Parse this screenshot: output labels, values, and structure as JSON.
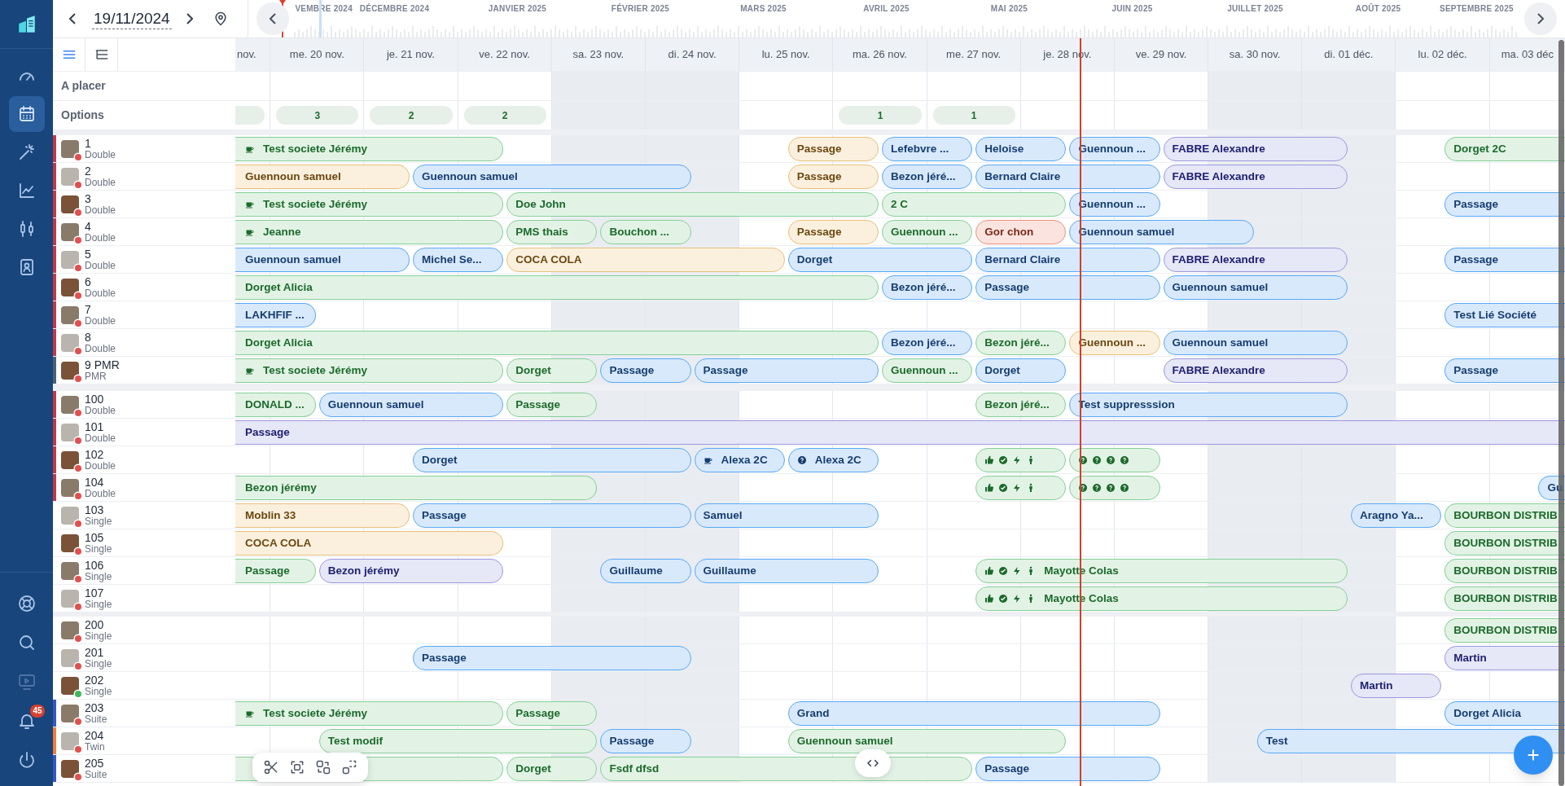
{
  "nav": {
    "top": [
      {
        "kind": "gauge",
        "selected": false
      },
      {
        "kind": "calendar",
        "selected": true
      },
      {
        "kind": "wand",
        "selected": false
      },
      {
        "kind": "chart",
        "selected": false
      },
      {
        "kind": "candles",
        "selected": false
      },
      {
        "kind": "contact",
        "selected": false
      }
    ],
    "bottom": [
      {
        "kind": "lifebuoy",
        "disabled": false
      },
      {
        "kind": "search",
        "disabled": false
      },
      {
        "kind": "monitor",
        "disabled": true
      },
      {
        "kind": "bell",
        "disabled": false,
        "badge": "45"
      },
      {
        "kind": "power",
        "disabled": false
      }
    ]
  },
  "date": "19/11/2024",
  "months": [
    "VEMBRE 2024",
    "DÉCEMBRE 2024",
    "JANVIER 2025",
    "FÉVRIER 2025",
    "MARS 2025",
    "AVRIL 2025",
    "MAI 2025",
    "JUIN 2025",
    "JUILLET 2025",
    "AOÛT 2025",
    "SEPTEMBRE 2025"
  ],
  "view_buttons": [
    {
      "kind": "list",
      "selected": true
    },
    {
      "kind": "tree",
      "selected": false
    }
  ],
  "days": [
    {
      "label": "nov.",
      "weekend": false
    },
    {
      "label": "me. 20 nov.",
      "weekend": false
    },
    {
      "label": "je. 21 nov.",
      "weekend": false
    },
    {
      "label": "ve. 22 nov.",
      "weekend": false
    },
    {
      "label": "sa. 23 nov.",
      "weekend": true
    },
    {
      "label": "di. 24 nov.",
      "weekend": true
    },
    {
      "label": "lu. 25 nov.",
      "weekend": false
    },
    {
      "label": "ma. 26 nov.",
      "weekend": false
    },
    {
      "label": "me. 27 nov.",
      "weekend": false
    },
    {
      "label": "je. 28 nov.",
      "weekend": false,
      "now": {
        "level": 0.63
      }
    },
    {
      "label": "ve. 29 nov.",
      "weekend": false
    },
    {
      "label": "sa. 30 nov.",
      "weekend": true
    },
    {
      "label": "di. 01 déc.",
      "weekend": true
    },
    {
      "label": "lu. 02 déc.",
      "weekend": false
    },
    {
      "label": "ma. 03 déc",
      "weekend": false
    }
  ],
  "to_place": {
    "label": "A placer"
  },
  "options": {
    "label": "Options",
    "cells": [
      {
        "kind": "pill"
      },
      {
        "kind": "pill",
        "count": "3"
      },
      {
        "kind": "pill",
        "count": "2"
      },
      {
        "kind": "pill",
        "count": "2"
      },
      {
        "kind": "none"
      },
      {
        "kind": "none"
      },
      {
        "kind": "none"
      },
      {
        "kind": "pill",
        "count": "1"
      },
      {
        "kind": "pill",
        "count": "1"
      }
    ]
  },
  "room_groups": [
    {
      "rooms": [
        {
          "number": "1",
          "type": "Double",
          "color": "#c0394b",
          "status": {
            "color": "#e0504f"
          },
          "timeline": [
            {
              "kind": "booking",
              "label": "Test societe Jérémy",
              "color": "#86cf98",
              "icons": [
                {
                  "kind": "cup"
                }
              ]
            },
            {
              "kind": "more"
            },
            {
              "kind": "more"
            },
            {
              "kind": "more"
            },
            {
              "kind": "free"
            },
            {
              "kind": "free"
            },
            {
              "kind": "free"
            },
            {
              "kind": "booking",
              "label": "Passage",
              "color": "#e8c07a"
            },
            {
              "kind": "booking",
              "label": "Lefebvre ...",
              "color": "#5aa9f5"
            },
            {
              "kind": "booking",
              "label": "Heloise",
              "color": "#5aa9f5"
            },
            {
              "kind": "booking",
              "label": "Guennoun ...",
              "color": "#5aa9f5"
            },
            {
              "kind": "booking",
              "label": "FABRE Alexandre",
              "color": "#9d98df"
            },
            {
              "kind": "more"
            },
            {
              "kind": "free"
            },
            {
              "kind": "booking",
              "label": "Dorget 2C",
              "color": "#86cf98"
            },
            {
              "kind": "more"
            }
          ]
        },
        {
          "number": "2",
          "type": "Double",
          "color": "#c0394b",
          "status": {
            "color": "#e0504f"
          },
          "timeline": [
            {
              "kind": "booking",
              "label": "Guennoun samuel",
              "color": "#e8c07a"
            },
            {
              "kind": "more"
            },
            {
              "kind": "more"
            },
            {
              "kind": "booking",
              "label": "Guennoun samuel",
              "color": "#5aa9f5"
            },
            {
              "kind": "more"
            },
            {
              "kind": "more"
            },
            {
              "kind": "free"
            },
            {
              "kind": "booking",
              "label": "Passage",
              "color": "#e8c07a"
            },
            {
              "kind": "booking",
              "label": "Bezon jéré...",
              "color": "#5aa9f5"
            },
            {
              "kind": "booking",
              "label": "Bernard Claire",
              "color": "#5aa9f5"
            },
            {
              "kind": "more"
            },
            {
              "kind": "booking",
              "label": "FABRE Alexandre",
              "color": "#9d98df"
            },
            {
              "kind": "more"
            }
          ]
        },
        {
          "number": "3",
          "type": "Double",
          "color": "#c0394b",
          "status": {
            "color": "#e0504f"
          },
          "timeline": [
            {
              "kind": "booking",
              "label": "Test societe Jérémy",
              "color": "#86cf98",
              "icons": [
                {
                  "kind": "cup"
                }
              ]
            },
            {
              "kind": "more"
            },
            {
              "kind": "more"
            },
            {
              "kind": "more"
            },
            {
              "kind": "booking",
              "label": "Doe John",
              "color": "#86cf98"
            },
            {
              "kind": "more"
            },
            {
              "kind": "more"
            },
            {
              "kind": "more"
            },
            {
              "kind": "booking",
              "label": "2 C",
              "color": "#86cf98"
            },
            {
              "kind": "more"
            },
            {
              "kind": "booking",
              "label": "Guennoun ...",
              "color": "#5aa9f5"
            },
            {
              "kind": "free"
            },
            {
              "kind": "free"
            },
            {
              "kind": "free"
            },
            {
              "kind": "booking",
              "label": "Passage",
              "color": "#5aa9f5"
            },
            {
              "kind": "more"
            }
          ]
        },
        {
          "number": "4",
          "type": "Double",
          "color": "#c0394b",
          "status": {
            "color": "#e0504f"
          },
          "timeline": [
            {
              "kind": "booking",
              "label": "Jeanne",
              "color": "#86cf98",
              "icons": [
                {
                  "kind": "cup"
                }
              ]
            },
            {
              "kind": "more"
            },
            {
              "kind": "more"
            },
            {
              "kind": "more"
            },
            {
              "kind": "booking",
              "label": "PMS thais",
              "color": "#86cf98"
            },
            {
              "kind": "booking",
              "label": "Bouchon ...",
              "color": "#86cf98"
            },
            {
              "kind": "free"
            },
            {
              "kind": "booking",
              "label": "Passage",
              "color": "#e8c07a"
            },
            {
              "kind": "booking",
              "label": "Guennoun ...",
              "color": "#86cf98"
            },
            {
              "kind": "booking",
              "label": "Gor chon",
              "color": "#ee8f7c"
            },
            {
              "kind": "booking",
              "label": "Guennoun samuel",
              "color": "#5aa9f5"
            },
            {
              "kind": "more"
            }
          ]
        },
        {
          "number": "5",
          "type": "Double",
          "color": "#c0394b",
          "status": {
            "color": "#e0504f"
          },
          "timeline": [
            {
              "kind": "booking",
              "label": "Guennoun samuel",
              "color": "#5aa9f5"
            },
            {
              "kind": "more"
            },
            {
              "kind": "more"
            },
            {
              "kind": "booking",
              "label": "Michel Se...",
              "color": "#5aa9f5"
            },
            {
              "kind": "booking",
              "label": "COCA COLA",
              "color": "#e8c07a"
            },
            {
              "kind": "more"
            },
            {
              "kind": "more"
            },
            {
              "kind": "booking",
              "label": "Dorget",
              "color": "#5aa9f5"
            },
            {
              "kind": "more"
            },
            {
              "kind": "booking",
              "label": "Bernard Claire",
              "color": "#5aa9f5"
            },
            {
              "kind": "more"
            },
            {
              "kind": "booking",
              "label": "FABRE Alexandre",
              "color": "#9d98df"
            },
            {
              "kind": "more"
            },
            {
              "kind": "free"
            },
            {
              "kind": "booking",
              "label": "Passage",
              "color": "#5aa9f5"
            },
            {
              "kind": "more"
            }
          ]
        },
        {
          "number": "6",
          "type": "Double",
          "color": "#c0394b",
          "status": {
            "color": "#e0504f"
          },
          "timeline": [
            {
              "kind": "booking",
              "label": "Dorget Alicia",
              "color": "#86cf98"
            },
            {
              "kind": "more"
            },
            {
              "kind": "more"
            },
            {
              "kind": "more"
            },
            {
              "kind": "more"
            },
            {
              "kind": "more"
            },
            {
              "kind": "more"
            },
            {
              "kind": "more"
            },
            {
              "kind": "booking",
              "label": "Bezon jéré...",
              "color": "#5aa9f5"
            },
            {
              "kind": "booking",
              "label": "Passage",
              "color": "#5aa9f5"
            },
            {
              "kind": "more"
            },
            {
              "kind": "booking",
              "label": "Guennoun samuel",
              "color": "#5aa9f5"
            },
            {
              "kind": "more"
            }
          ]
        },
        {
          "number": "7",
          "type": "Double",
          "color": "#c0394b",
          "status": {
            "color": "#e0504f"
          },
          "timeline": [
            {
              "kind": "booking",
              "label": "LAKHFIF ...",
              "color": "#5aa9f5"
            },
            {
              "kind": "more"
            },
            {
              "kind": "free"
            },
            {
              "kind": "free"
            },
            {
              "kind": "free"
            },
            {
              "kind": "free"
            },
            {
              "kind": "free"
            },
            {
              "kind": "free"
            },
            {
              "kind": "free"
            },
            {
              "kind": "free"
            },
            {
              "kind": "free"
            },
            {
              "kind": "free"
            },
            {
              "kind": "free"
            },
            {
              "kind": "free"
            },
            {
              "kind": "booking",
              "label": "Test Lié Société",
              "color": "#5aa9f5"
            },
            {
              "kind": "more"
            }
          ]
        },
        {
          "number": "8",
          "type": "Double",
          "color": "#c0394b",
          "status": {
            "color": "#e0504f"
          },
          "timeline": [
            {
              "kind": "booking",
              "label": "Dorget Alicia",
              "color": "#86cf98"
            },
            {
              "kind": "more"
            },
            {
              "kind": "more"
            },
            {
              "kind": "more"
            },
            {
              "kind": "more"
            },
            {
              "kind": "more"
            },
            {
              "kind": "more"
            },
            {
              "kind": "more"
            },
            {
              "kind": "booking",
              "label": "Bezon jéré...",
              "color": "#5aa9f5"
            },
            {
              "kind": "booking",
              "label": "Bezon jéré...",
              "color": "#86cf98"
            },
            {
              "kind": "booking",
              "label": "Guennoun ...",
              "color": "#e8c07a"
            },
            {
              "kind": "booking",
              "label": "Guennoun samuel",
              "color": "#5aa9f5"
            },
            {
              "kind": "more"
            }
          ]
        },
        {
          "number": "9 PMR",
          "type": "PMR",
          "color": "#4b6075",
          "status": {
            "color": "#e0504f"
          },
          "timeline": [
            {
              "kind": "booking",
              "label": "Test societe Jérémy",
              "color": "#86cf98",
              "icons": [
                {
                  "kind": "cup"
                }
              ]
            },
            {
              "kind": "more"
            },
            {
              "kind": "more"
            },
            {
              "kind": "more"
            },
            {
              "kind": "booking",
              "label": "Dorget",
              "color": "#86cf98"
            },
            {
              "kind": "booking",
              "label": "Passage",
              "color": "#5aa9f5"
            },
            {
              "kind": "booking",
              "label": "Passage",
              "color": "#5aa9f5"
            },
            {
              "kind": "more"
            },
            {
              "kind": "booking",
              "label": "Guennoun ...",
              "color": "#86cf98"
            },
            {
              "kind": "booking",
              "label": "Dorget",
              "color": "#5aa9f5"
            },
            {
              "kind": "free"
            },
            {
              "kind": "booking",
              "label": "FABRE Alexandre",
              "color": "#9d98df"
            },
            {
              "kind": "more"
            },
            {
              "kind": "free"
            },
            {
              "kind": "booking",
              "label": "Passage",
              "color": "#5aa9f5"
            },
            {
              "kind": "more"
            }
          ]
        }
      ]
    },
    {
      "rooms": [
        {
          "number": "100",
          "type": "Double",
          "color": "#c0394b",
          "status": {
            "color": "#e0504f"
          },
          "timeline": [
            {
              "kind": "booking",
              "label": "DONALD ...",
              "color": "#86cf98"
            },
            {
              "kind": "more"
            },
            {
              "kind": "booking",
              "label": "Guennoun samuel",
              "color": "#5aa9f5"
            },
            {
              "kind": "more"
            },
            {
              "kind": "booking",
              "label": "Passage",
              "color": "#86cf98"
            },
            {
              "kind": "free"
            },
            {
              "kind": "free"
            },
            {
              "kind": "free"
            },
            {
              "kind": "free"
            },
            {
              "kind": "booking",
              "label": "Bezon jéré...",
              "color": "#86cf98"
            },
            {
              "kind": "booking",
              "label": "Test suppresssion",
              "color": "#5aa9f5"
            },
            {
              "kind": "more"
            },
            {
              "kind": "more"
            }
          ]
        },
        {
          "number": "101",
          "type": "Double",
          "color": "#c0394b",
          "status": {
            "color": "#e0504f"
          },
          "timeline": [
            {
              "kind": "booking",
              "label": "Passage",
              "color": "#9d98df"
            },
            {
              "kind": "more"
            },
            {
              "kind": "more"
            },
            {
              "kind": "more"
            },
            {
              "kind": "more"
            },
            {
              "kind": "more"
            },
            {
              "kind": "more"
            },
            {
              "kind": "more"
            },
            {
              "kind": "more"
            },
            {
              "kind": "more"
            },
            {
              "kind": "more"
            },
            {
              "kind": "more"
            },
            {
              "kind": "more"
            },
            {
              "kind": "more"
            },
            {
              "kind": "more"
            },
            {
              "kind": "more"
            }
          ]
        },
        {
          "number": "102",
          "type": "Double",
          "color": "#c0394b",
          "status": {
            "color": "#e0504f"
          },
          "timeline": [
            {
              "kind": "free"
            },
            {
              "kind": "free"
            },
            {
              "kind": "free"
            },
            {
              "kind": "booking",
              "label": "Dorget",
              "color": "#5aa9f5"
            },
            {
              "kind": "more"
            },
            {
              "kind": "more"
            },
            {
              "kind": "booking",
              "label": "Alexa 2C",
              "color": "#5aa9f5",
              "icons": [
                {
                  "kind": "cup"
                }
              ]
            },
            {
              "kind": "booking",
              "label": "Alexa 2C",
              "color": "#5aa9f5",
              "icons": [
                {
                  "kind": "question"
                }
              ]
            },
            {
              "kind": "free"
            },
            {
              "kind": "booking",
              "color": "#86cf98",
              "icons": [
                {
                  "kind": "thumbs-up"
                },
                {
                  "kind": "check"
                },
                {
                  "kind": "bolt"
                },
                {
                  "kind": "person"
                }
              ]
            },
            {
              "kind": "booking",
              "color": "#86cf98",
              "icons": [
                {
                  "kind": "question"
                },
                {
                  "kind": "question"
                },
                {
                  "kind": "question"
                },
                {
                  "kind": "question"
                }
              ]
            }
          ]
        },
        {
          "number": "104",
          "type": "Double",
          "color": "#c0394b",
          "status": {
            "color": "#e0504f"
          },
          "timeline": [
            {
              "kind": "booking",
              "label": "Bezon jérémy",
              "color": "#86cf98"
            },
            {
              "kind": "more"
            },
            {
              "kind": "more"
            },
            {
              "kind": "more"
            },
            {
              "kind": "more"
            },
            {
              "kind": "free"
            },
            {
              "kind": "free"
            },
            {
              "kind": "free"
            },
            {
              "kind": "free"
            },
            {
              "kind": "booking",
              "color": "#86cf98",
              "icons": [
                {
                  "kind": "thumbs-up"
                },
                {
                  "kind": "check"
                },
                {
                  "kind": "bolt"
                },
                {
                  "kind": "person"
                }
              ]
            },
            {
              "kind": "booking",
              "color": "#86cf98",
              "icons": [
                {
                  "kind": "question"
                },
                {
                  "kind": "question"
                },
                {
                  "kind": "question"
                },
                {
                  "kind": "question"
                }
              ]
            },
            {
              "kind": "free"
            },
            {
              "kind": "free"
            },
            {
              "kind": "free"
            },
            {
              "kind": "free"
            },
            {
              "kind": "booking",
              "label": "Gu",
              "color": "#5aa9f5"
            }
          ]
        },
        {
          "number": "103",
          "type": "Single",
          "status": {
            "color": "#e0504f"
          },
          "timeline": [
            {
              "kind": "booking",
              "label": "Moblin 33",
              "color": "#e8c07a"
            },
            {
              "kind": "more"
            },
            {
              "kind": "more"
            },
            {
              "kind": "booking",
              "label": "Passage",
              "color": "#5aa9f5"
            },
            {
              "kind": "more"
            },
            {
              "kind": "more"
            },
            {
              "kind": "booking",
              "label": "Samuel",
              "color": "#5aa9f5"
            },
            {
              "kind": "more"
            },
            {
              "kind": "free"
            },
            {
              "kind": "free"
            },
            {
              "kind": "free"
            },
            {
              "kind": "free"
            },
            {
              "kind": "free"
            },
            {
              "kind": "booking",
              "label": "Aragno Ya...",
              "color": "#5aa9f5"
            },
            {
              "kind": "booking",
              "label": "BOURBON DISTRIB",
              "color": "#86cf98"
            },
            {
              "kind": "more"
            }
          ]
        },
        {
          "number": "105",
          "type": "Single",
          "status": {
            "color": "#e0504f"
          },
          "timeline": [
            {
              "kind": "booking",
              "label": "COCA COLA",
              "color": "#e8c07a"
            },
            {
              "kind": "more"
            },
            {
              "kind": "more"
            },
            {
              "kind": "more"
            },
            {
              "kind": "free"
            },
            {
              "kind": "free"
            },
            {
              "kind": "free"
            },
            {
              "kind": "free"
            },
            {
              "kind": "free"
            },
            {
              "kind": "free"
            },
            {
              "kind": "free"
            },
            {
              "kind": "free"
            },
            {
              "kind": "free"
            },
            {
              "kind": "free"
            },
            {
              "kind": "booking",
              "label": "BOURBON DISTRIB",
              "color": "#86cf98"
            },
            {
              "kind": "more"
            }
          ]
        },
        {
          "number": "106",
          "type": "Single",
          "status": {
            "color": "#e0504f"
          },
          "timeline": [
            {
              "kind": "booking",
              "label": "Passage",
              "color": "#86cf98"
            },
            {
              "kind": "more"
            },
            {
              "kind": "booking",
              "label": "Bezon jérémy",
              "color": "#9d98df"
            },
            {
              "kind": "more"
            },
            {
              "kind": "free"
            },
            {
              "kind": "booking",
              "label": "Guillaume",
              "color": "#5aa9f5"
            },
            {
              "kind": "booking",
              "label": "Guillaume",
              "color": "#5aa9f5"
            },
            {
              "kind": "more"
            },
            {
              "kind": "free"
            },
            {
              "kind": "booking",
              "label": "Mayotte Colas",
              "color": "#86cf98",
              "icons": [
                {
                  "kind": "thumbs-up"
                },
                {
                  "kind": "check"
                },
                {
                  "kind": "bolt"
                },
                {
                  "kind": "person"
                }
              ]
            },
            {
              "kind": "more"
            },
            {
              "kind": "more"
            },
            {
              "kind": "more"
            },
            {
              "kind": "free"
            },
            {
              "kind": "booking",
              "label": "BOURBON DISTRIB",
              "color": "#86cf98"
            },
            {
              "kind": "more"
            }
          ]
        },
        {
          "number": "107",
          "type": "Single",
          "status": {
            "color": "#e0504f"
          },
          "timeline": [
            {
              "kind": "free"
            },
            {
              "kind": "free"
            },
            {
              "kind": "free"
            },
            {
              "kind": "free"
            },
            {
              "kind": "free"
            },
            {
              "kind": "free"
            },
            {
              "kind": "free"
            },
            {
              "kind": "free"
            },
            {
              "kind": "free"
            },
            {
              "kind": "booking",
              "label": "Mayotte Colas",
              "color": "#86cf98",
              "icons": [
                {
                  "kind": "thumbs-up"
                },
                {
                  "kind": "check"
                },
                {
                  "kind": "bolt"
                },
                {
                  "kind": "person"
                }
              ]
            },
            {
              "kind": "more"
            },
            {
              "kind": "more"
            },
            {
              "kind": "more"
            },
            {
              "kind": "free"
            },
            {
              "kind": "booking",
              "label": "BOURBON DISTRIB",
              "color": "#86cf98"
            },
            {
              "kind": "more"
            }
          ]
        }
      ]
    },
    {
      "rooms": [
        {
          "number": "200",
          "type": "Single",
          "status": {
            "color": "#e0504f"
          },
          "timeline": [
            {
              "kind": "free"
            },
            {
              "kind": "free"
            },
            {
              "kind": "free"
            },
            {
              "kind": "free"
            },
            {
              "kind": "free"
            },
            {
              "kind": "free"
            },
            {
              "kind": "free"
            },
            {
              "kind": "free"
            },
            {
              "kind": "free"
            },
            {
              "kind": "free"
            },
            {
              "kind": "free"
            },
            {
              "kind": "free"
            },
            {
              "kind": "free"
            },
            {
              "kind": "free"
            },
            {
              "kind": "booking",
              "label": "BOURBON DISTRIB",
              "color": "#86cf98"
            },
            {
              "kind": "more"
            }
          ]
        },
        {
          "number": "201",
          "type": "Single",
          "status": {
            "color": "#e0504f"
          },
          "timeline": [
            {
              "kind": "free"
            },
            {
              "kind": "free"
            },
            {
              "kind": "free"
            },
            {
              "kind": "booking",
              "label": "Passage",
              "color": "#5aa9f5"
            },
            {
              "kind": "more"
            },
            {
              "kind": "more"
            },
            {
              "kind": "free"
            },
            {
              "kind": "free"
            },
            {
              "kind": "free"
            },
            {
              "kind": "free"
            },
            {
              "kind": "free"
            },
            {
              "kind": "free"
            },
            {
              "kind": "free"
            },
            {
              "kind": "free"
            },
            {
              "kind": "booking",
              "label": "Martin",
              "color": "#9d98df"
            },
            {
              "kind": "more"
            }
          ]
        },
        {
          "number": "202",
          "type": "Single",
          "status": {
            "color": "#3fb95d"
          },
          "timeline": [
            {
              "kind": "free"
            },
            {
              "kind": "free"
            },
            {
              "kind": "free"
            },
            {
              "kind": "free"
            },
            {
              "kind": "free"
            },
            {
              "kind": "free"
            },
            {
              "kind": "free"
            },
            {
              "kind": "free"
            },
            {
              "kind": "free"
            },
            {
              "kind": "free"
            },
            {
              "kind": "free"
            },
            {
              "kind": "free"
            },
            {
              "kind": "free"
            },
            {
              "kind": "booking",
              "label": "Martin",
              "color": "#9d98df"
            }
          ]
        },
        {
          "number": "203",
          "type": "Suite",
          "color": "#3556c4",
          "status": {
            "color": "#e0504f"
          },
          "timeline": [
            {
              "kind": "booking",
              "label": "Test societe Jérémy",
              "color": "#86cf98",
              "icons": [
                {
                  "kind": "cup"
                }
              ]
            },
            {
              "kind": "more"
            },
            {
              "kind": "more"
            },
            {
              "kind": "more"
            },
            {
              "kind": "booking",
              "label": "Passage",
              "color": "#86cf98"
            },
            {
              "kind": "free"
            },
            {
              "kind": "free"
            },
            {
              "kind": "booking",
              "label": "Grand",
              "color": "#5aa9f5"
            },
            {
              "kind": "more"
            },
            {
              "kind": "more"
            },
            {
              "kind": "more"
            },
            {
              "kind": "free"
            },
            {
              "kind": "free"
            },
            {
              "kind": "free"
            },
            {
              "kind": "booking",
              "label": "Dorget Alicia",
              "color": "#5aa9f5"
            },
            {
              "kind": "more"
            }
          ]
        },
        {
          "number": "204",
          "type": "Twin",
          "color": "#ef7d3c",
          "status": {
            "color": "#e0504f"
          },
          "timeline": [
            {
              "kind": "free"
            },
            {
              "kind": "free"
            },
            {
              "kind": "booking",
              "label": "Test modif",
              "color": "#86cf98"
            },
            {
              "kind": "more"
            },
            {
              "kind": "more"
            },
            {
              "kind": "booking",
              "label": "Passage",
              "color": "#5aa9f5"
            },
            {
              "kind": "free"
            },
            {
              "kind": "booking",
              "label": "Guennoun samuel",
              "color": "#86cf98"
            },
            {
              "kind": "more"
            },
            {
              "kind": "more"
            },
            {
              "kind": "free"
            },
            {
              "kind": "free"
            },
            {
              "kind": "booking",
              "label": "Test",
              "color": "#5aa9f5"
            },
            {
              "kind": "more"
            },
            {
              "kind": "more"
            },
            {
              "kind": "more"
            }
          ]
        },
        {
          "number": "205",
          "type": "Suite",
          "color": "#3556c4",
          "status": {
            "color": "#e0504f"
          },
          "timeline": [
            {
              "kind": "booking",
              "color": "#86cf98"
            },
            {
              "kind": "more"
            },
            {
              "kind": "more"
            },
            {
              "kind": "more"
            },
            {
              "kind": "booking",
              "label": "Dorget",
              "color": "#86cf98"
            },
            {
              "kind": "booking",
              "label": "Fsdf dfsd",
              "color": "#86cf98"
            },
            {
              "kind": "more"
            },
            {
              "kind": "more"
            },
            {
              "kind": "more"
            },
            {
              "kind": "booking",
              "label": "Passage",
              "color": "#5aa9f5"
            },
            {
              "kind": "more"
            }
          ]
        }
      ]
    }
  ],
  "toolbar": [
    {
      "kind": "scissors"
    },
    {
      "kind": "focus"
    },
    {
      "kind": "swap"
    },
    {
      "kind": "select"
    }
  ]
}
